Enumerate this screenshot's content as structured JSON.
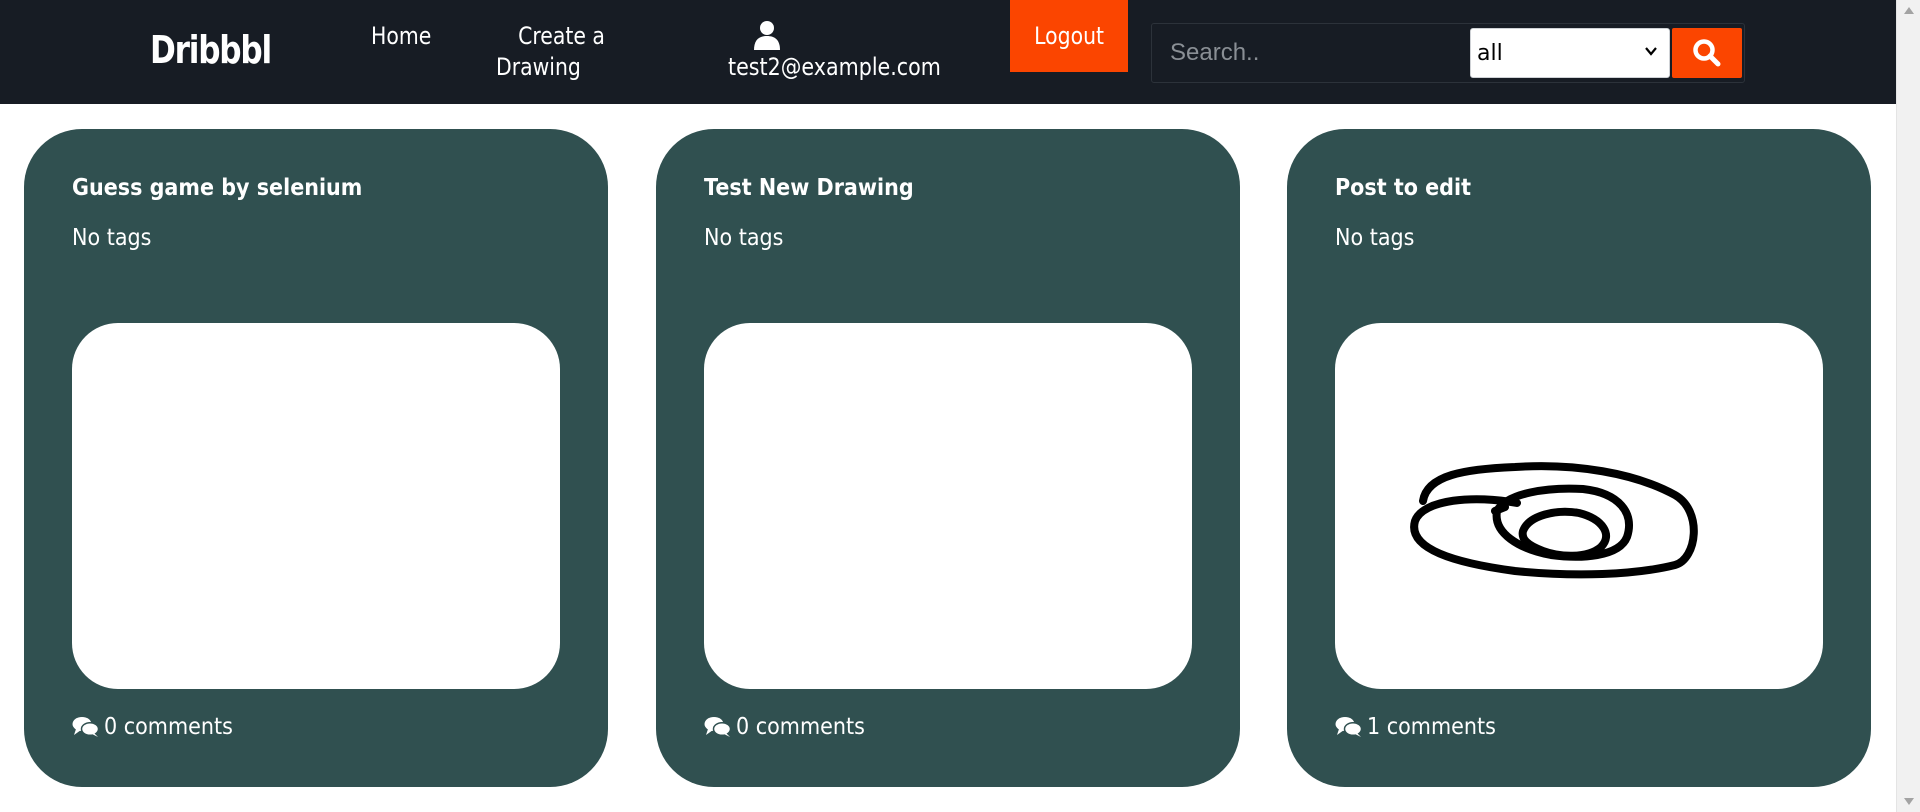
{
  "navbar": {
    "brand": "Dribbbl",
    "home_label": "Home",
    "create_label_line1": "Create a",
    "create_label_line2": "Drawing",
    "user_email": "test2@example.com",
    "logout_label": "Logout",
    "search": {
      "placeholder": "Search..",
      "value": "",
      "filter_selected": "all"
    }
  },
  "cards": [
    {
      "title": "Guess game by selenium",
      "tags": "No tags",
      "comments": "0 comments",
      "has_drawing": false
    },
    {
      "title": "Test New Drawing",
      "tags": "No tags",
      "comments": "0 comments",
      "has_drawing": false
    },
    {
      "title": "Post to edit",
      "tags": "No tags",
      "comments": "1 comments",
      "has_drawing": true
    }
  ],
  "colors": {
    "navbar_bg": "#171c24",
    "accent": "#fb4500",
    "card_bg": "#305050"
  },
  "icons": {
    "user": "user-icon",
    "search": "search-icon",
    "comments": "comments-icon",
    "select_chevron": "chevron-down-icon"
  }
}
